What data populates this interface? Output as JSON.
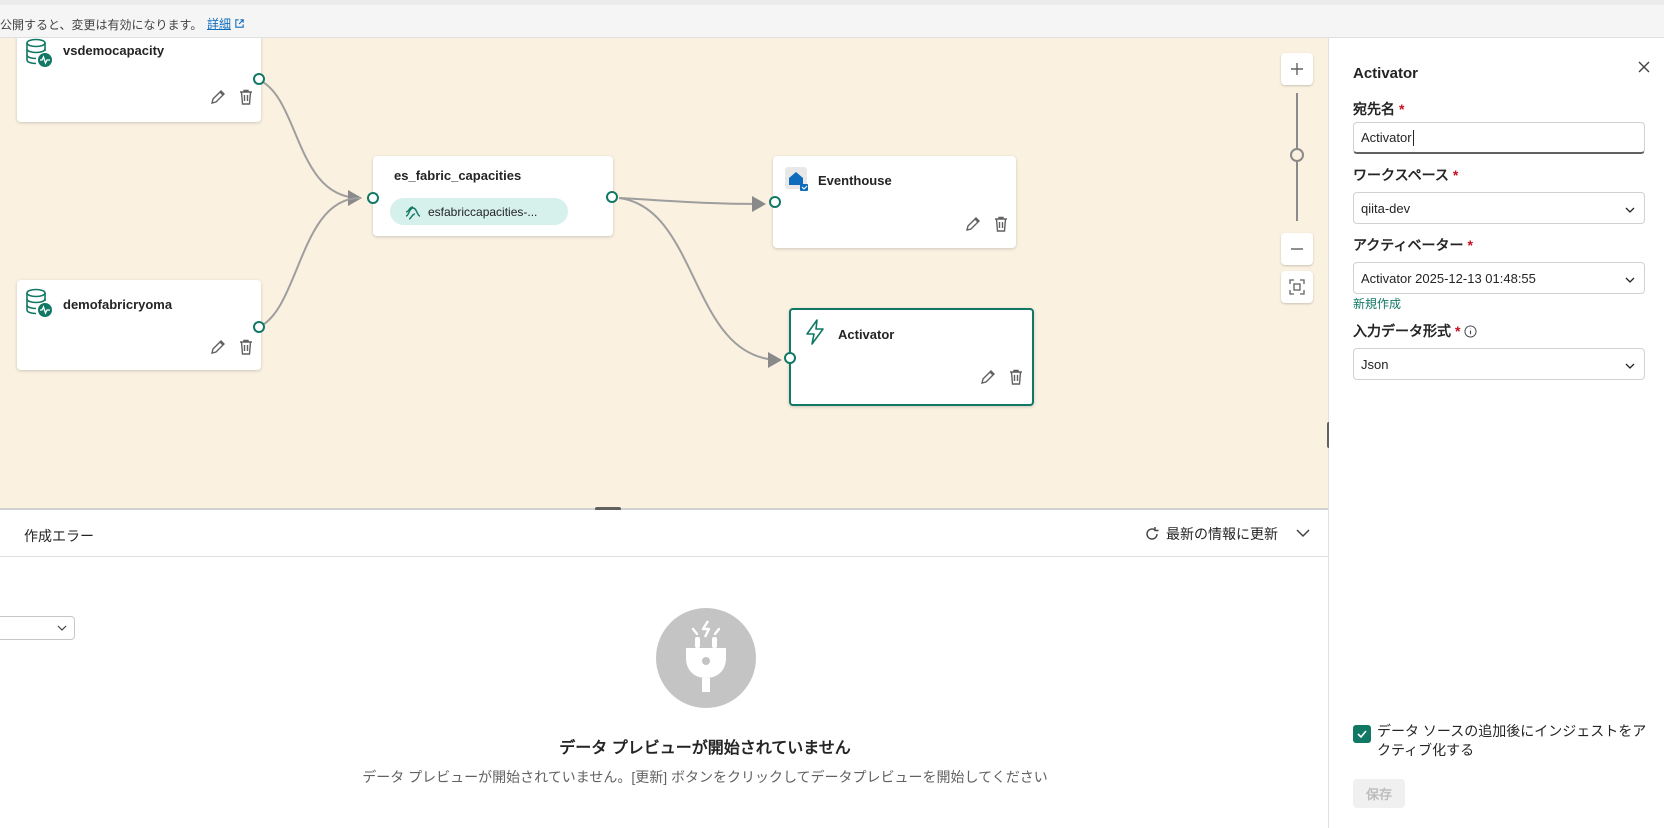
{
  "infobar": {
    "message": "公開すると、変更は有効になります。",
    "link_label": "詳細"
  },
  "canvas": {
    "nodes": {
      "source1": {
        "title": "vsdemocapacity",
        "icon": "database-icon"
      },
      "source2": {
        "title": "demofabricryoma",
        "icon": "database-icon"
      },
      "stream": {
        "title": "es_fabric_capacities",
        "chip_label": "esfabriccapacities-...",
        "chip_icon": "eventstream-icon"
      },
      "eventhouse": {
        "title": "Eventhouse",
        "icon": "eventhouse-icon"
      },
      "activator": {
        "title": "Activator",
        "icon": "lightning-icon",
        "selected": true
      }
    },
    "node_actions": [
      "edit-icon",
      "delete-icon"
    ],
    "zoom_controls": [
      "zoom-in-button",
      "zoom-slider",
      "zoom-out-button",
      "fit-view-button"
    ]
  },
  "bottom": {
    "tab_label": "作成エラー",
    "refresh_label": "最新の情報に更新",
    "empty_title": "データ プレビューが開始されていません",
    "empty_desc": "データ プレビューが開始されていません。[更新] ボタンをクリックしてデータプレビューを開始してください"
  },
  "panel": {
    "title": "Activator",
    "dest_label": "宛先名",
    "dest_value": "Activator",
    "workspace_label": "ワークスペース",
    "workspace_value": "qiita-dev",
    "activator_label": "アクティベーター",
    "activator_value": "Activator 2025-12-13 01:48:55",
    "new_link": "新規作成",
    "format_label": "入力データ形式",
    "format_value": "Json",
    "required_mark": "*",
    "checkbox_label": "データ ソースの追加後にインジェストをアクティブ化する",
    "checkbox_checked": true,
    "save_label": "保存"
  },
  "colors": {
    "accent": "#117865",
    "canvas_bg": "#faf1e1",
    "required": "#c50f1f"
  }
}
